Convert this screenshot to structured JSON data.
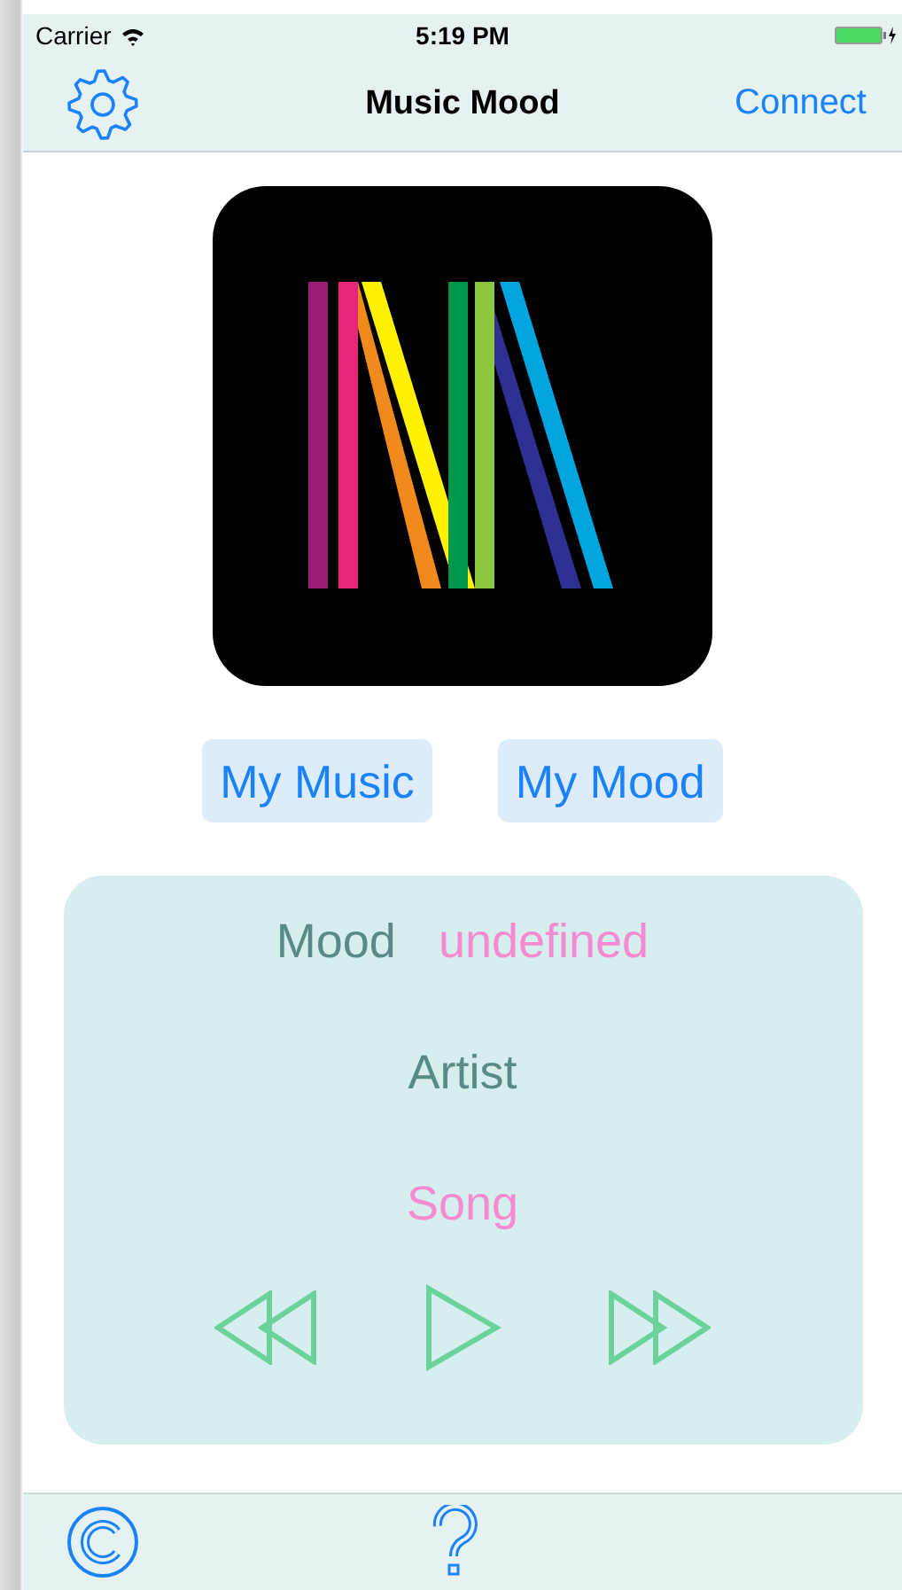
{
  "status_bar": {
    "carrier": "Carrier",
    "time": "5:19 PM"
  },
  "nav_bar": {
    "title": "Music Mood",
    "action": "Connect"
  },
  "buttons": [
    "My Music",
    "My Mood"
  ],
  "now_playing": {
    "mood_label": "Mood",
    "mood_value": "undefined",
    "artist": "Artist",
    "song": "Song"
  }
}
